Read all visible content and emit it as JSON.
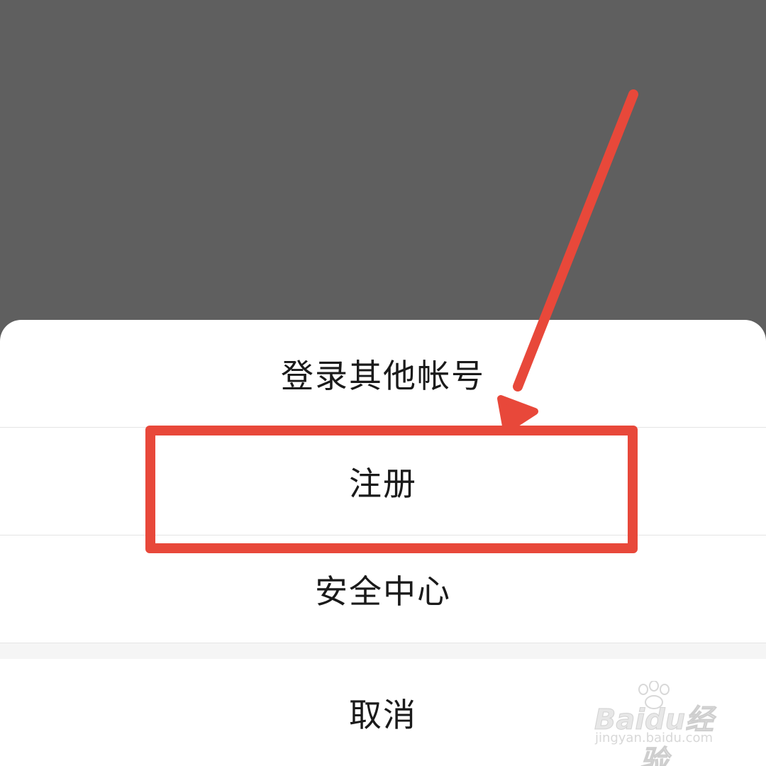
{
  "action_sheet": {
    "items": [
      {
        "label": "登录其他帐号"
      },
      {
        "label": "注册"
      },
      {
        "label": "安全中心"
      }
    ],
    "cancel_label": "取消"
  },
  "annotation": {
    "color": "#e8483a",
    "highlighted_item": "注册"
  },
  "watermark": {
    "brand": "Baidu经验",
    "url": "jingyan.baidu.com"
  }
}
